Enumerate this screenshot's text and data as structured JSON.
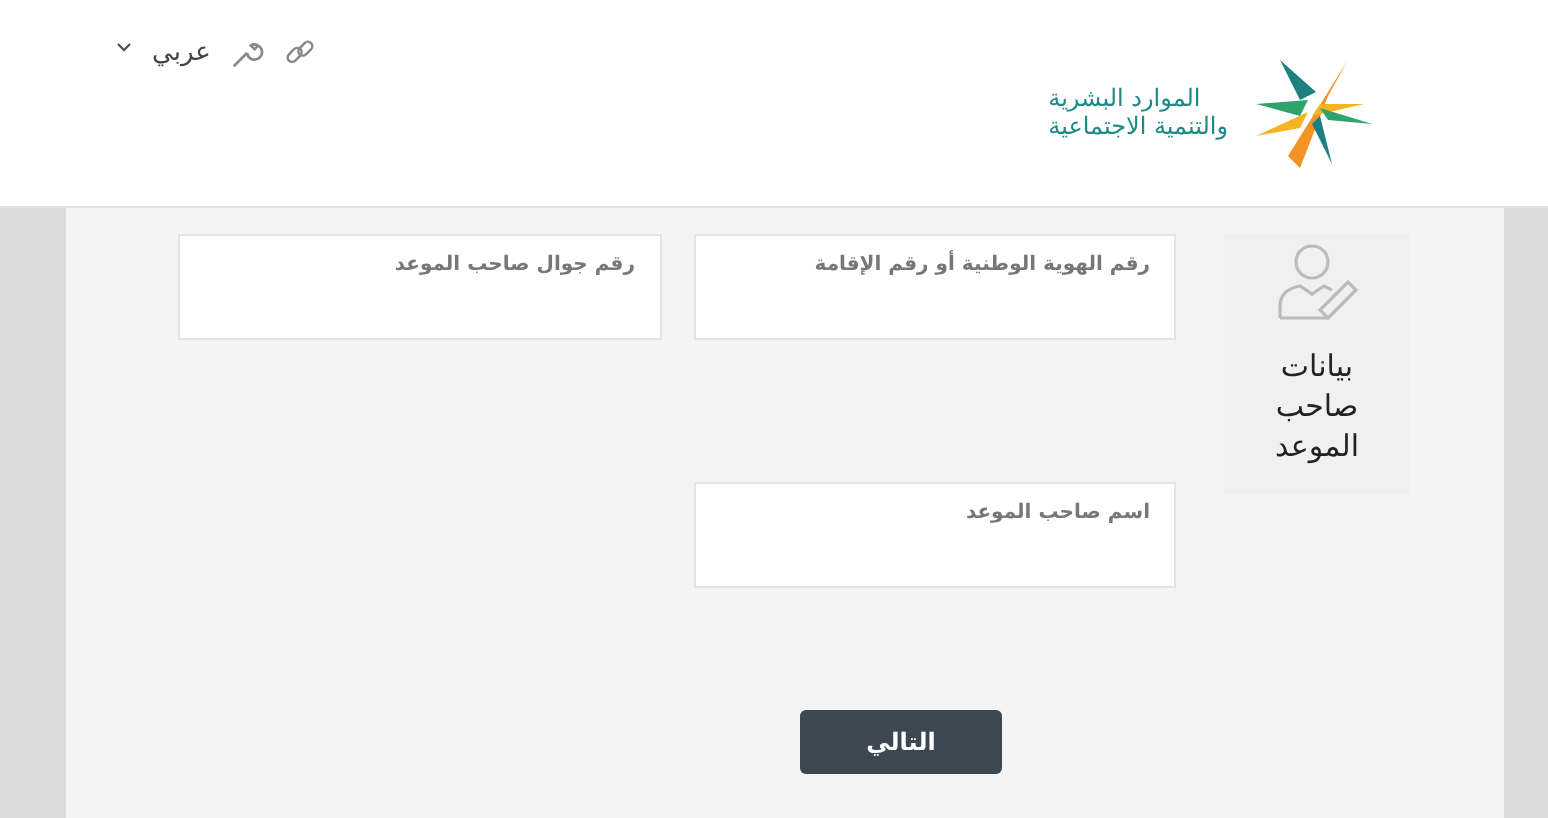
{
  "header": {
    "logo_text": [
      "الموارد البشرية",
      "والتنمية الاجتماعية"
    ],
    "language": "عربي"
  },
  "step": {
    "title": "بيانات صاحب الموعد"
  },
  "fields": [
    {
      "label": "رقم الهوية الوطنية أو رقم الإقامة"
    },
    {
      "label": "رقم جوال صاحب الموعد"
    },
    {
      "label": "اسم صاحب الموعد"
    }
  ],
  "next_button": "التالي"
}
